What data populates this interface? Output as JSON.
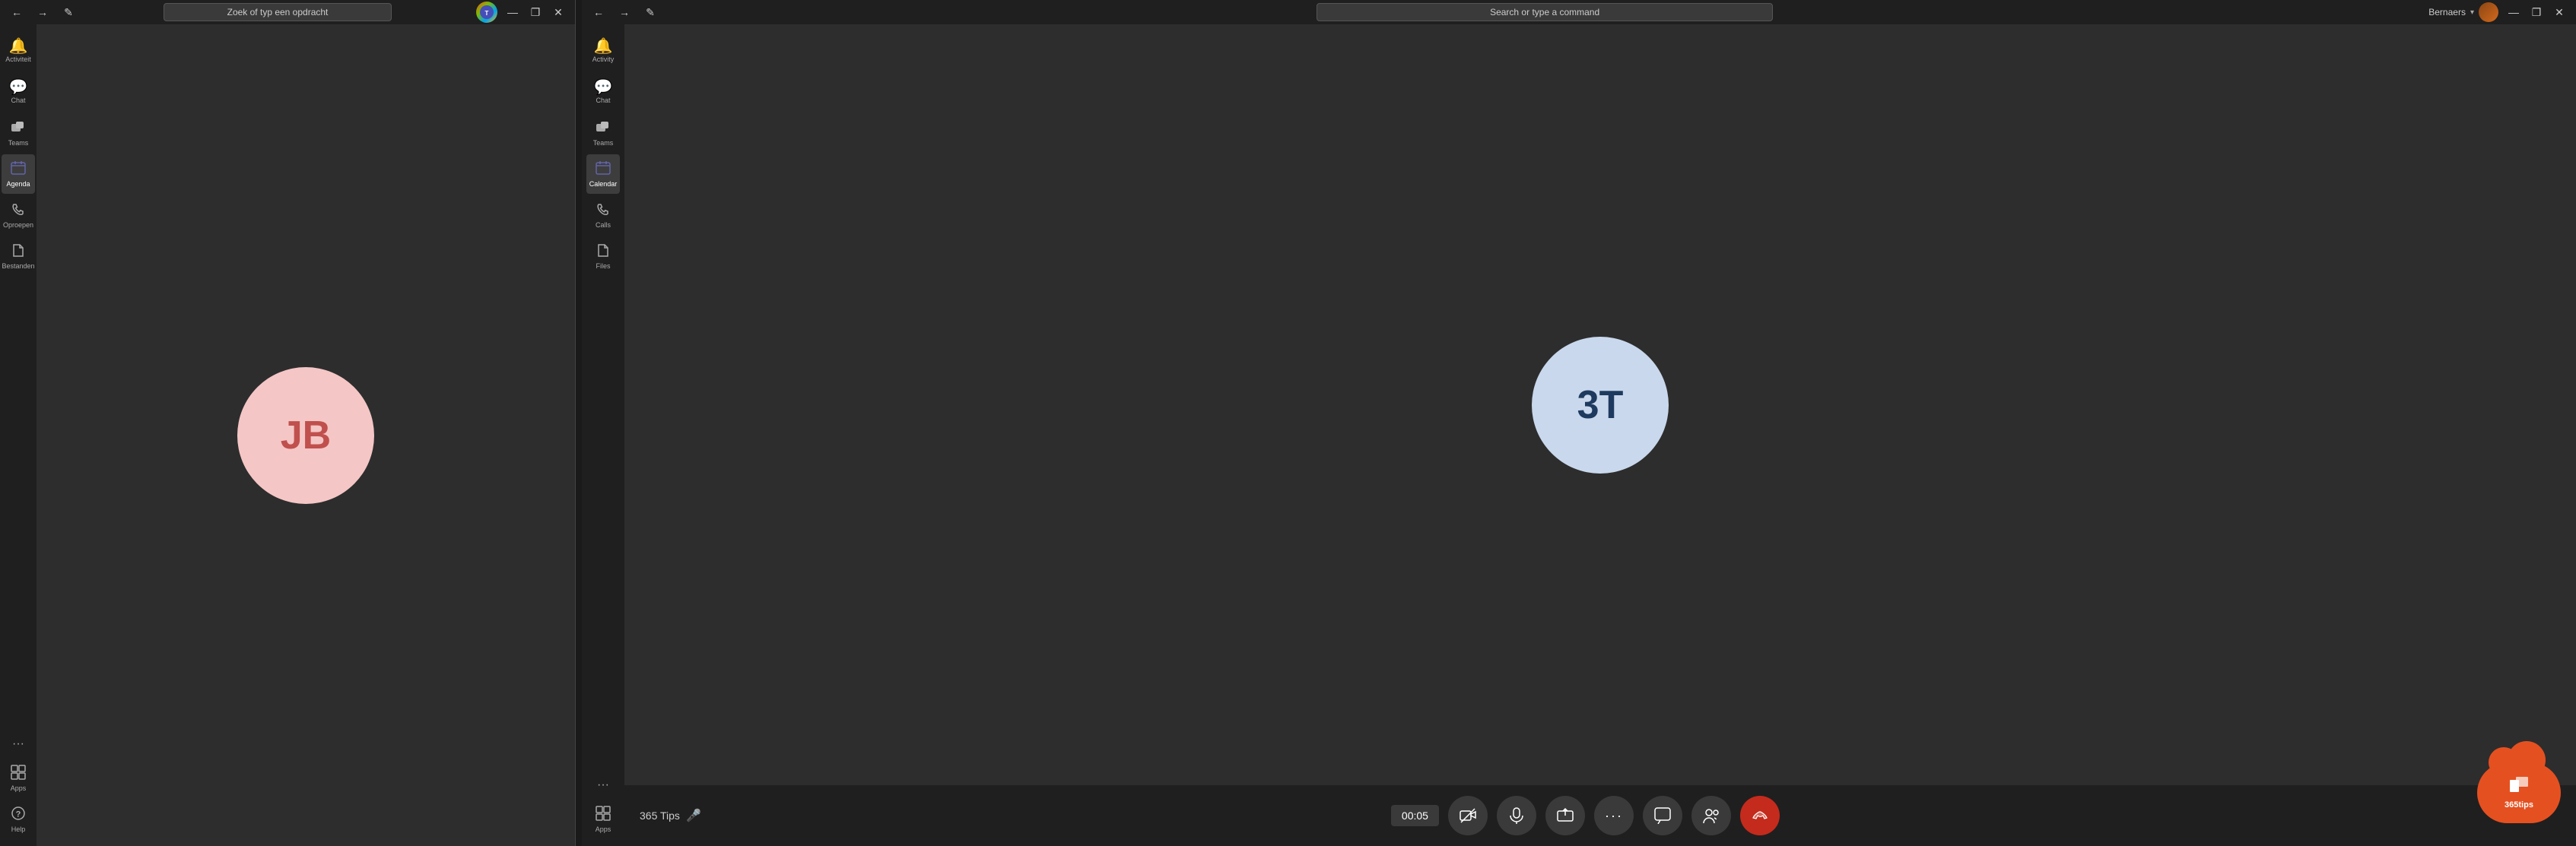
{
  "leftWindow": {
    "titlebar": {
      "searchPlaceholder": "Zoek of typ een opdracht",
      "backBtn": "←",
      "forwardBtn": "→",
      "composeBtn": "✏",
      "minimizeBtn": "—",
      "maximizeBtn": "❐",
      "closeBtn": "✕"
    },
    "sidebar": {
      "items": [
        {
          "id": "activity",
          "label": "Activiteit",
          "icon": "🔔"
        },
        {
          "id": "chat",
          "label": "Chat",
          "icon": "💬"
        },
        {
          "id": "teams",
          "label": "Teams",
          "icon": "⊞"
        },
        {
          "id": "calendar",
          "label": "Agenda",
          "icon": "📅"
        },
        {
          "id": "calls",
          "label": "Oproepen",
          "icon": "📞"
        },
        {
          "id": "files",
          "label": "Bestanden",
          "icon": "📄"
        },
        {
          "id": "help",
          "label": "Help",
          "icon": "?"
        }
      ],
      "activeItem": "calendar",
      "moreLabel": "···",
      "appsLabel": "Apps"
    },
    "callArea": {
      "avatarInitials": "JB",
      "avatarBg": "#f5c6c6",
      "avatarColor": "#c0504d"
    }
  },
  "rightWindow": {
    "titlebar": {
      "backBtn": "←",
      "forwardBtn": "→",
      "composeBtn": "✏",
      "searchPlaceholder": "Search or type a command",
      "username": "Bernaers",
      "minimizeBtn": "—",
      "maximizeBtn": "❐",
      "closeBtn": "✕"
    },
    "sidebar": {
      "items": [
        {
          "id": "activity",
          "label": "Activity",
          "icon": "🔔"
        },
        {
          "id": "chat",
          "label": "Chat",
          "icon": "💬"
        },
        {
          "id": "teams",
          "label": "Teams",
          "icon": "⊞"
        },
        {
          "id": "calendar",
          "label": "Calendar",
          "icon": "📅"
        },
        {
          "id": "calls",
          "label": "Calls",
          "icon": "📞"
        },
        {
          "id": "files",
          "label": "Files",
          "icon": "📄"
        }
      ],
      "moreLabel": "···",
      "appsLabel": "Apps"
    },
    "callArea": {
      "avatarInitials": "3T",
      "avatarBg": "#c9d8ec",
      "avatarColor": "#1e3a5f"
    },
    "callControls": {
      "callerName": "365 Tips",
      "timer": "00:05",
      "buttons": [
        {
          "id": "camera",
          "icon": "📷",
          "label": "Camera off"
        },
        {
          "id": "mic",
          "icon": "🎤",
          "label": "Mute"
        },
        {
          "id": "share",
          "icon": "⬆",
          "label": "Share"
        },
        {
          "id": "more",
          "icon": "···",
          "label": "More"
        },
        {
          "id": "chat-btn",
          "icon": "💬",
          "label": "Chat"
        },
        {
          "id": "participants",
          "icon": "👥",
          "label": "Participants"
        },
        {
          "id": "end-call",
          "icon": "📵",
          "label": "End call"
        }
      ]
    },
    "tipsLogo": {
      "text": "365tips",
      "icon": "☁"
    }
  }
}
